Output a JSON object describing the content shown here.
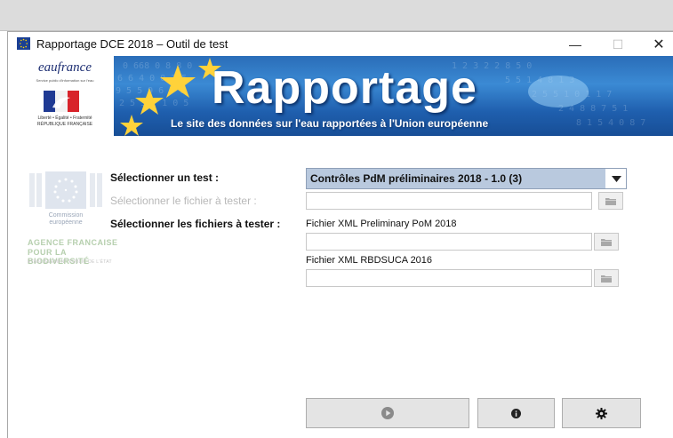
{
  "window": {
    "title": "Rapportage DCE 2018 – Outil de test",
    "controls": {
      "minimize": "—",
      "maximize": "☐",
      "close": "✕"
    }
  },
  "logos": {
    "eaufrance": {
      "name": "eaufrance",
      "tagline": "Service public d'information sur l'eau"
    },
    "republique": {
      "motto": "Liberté • Égalité • Fraternité",
      "name": "RÉPUBLIQUE FRANÇAISE"
    },
    "commission": {
      "line1": "Commission",
      "line2": "européenne"
    },
    "afb": {
      "line1": "AGENCE FRANCAISE",
      "line2": "POUR LA BIODIVERSITÉ",
      "line3": "ÉTABLISSEMENT PUBLIC DE L'ÉTAT"
    }
  },
  "banner": {
    "title": "Rapportage",
    "subtitle": "Le site des données sur l'eau rapportées à l'Union européenne"
  },
  "form": {
    "select_test_label": "Sélectionner un test :",
    "select_test_value": "Contrôles PdM préliminaires 2018 - 1.0 (3)",
    "select_file_label": "Sélectionner le fichier à tester :",
    "select_files_label": "Sélectionner les fichiers à tester :",
    "file1_label": "Fichier XML Preliminary PoM 2018",
    "file2_label": "Fichier XML RBDSUCA 2016",
    "single_file_value": "",
    "file1_value": "",
    "file2_value": ""
  },
  "icons": {
    "app": "eu-flag-icon",
    "dropdown": "chevron-down-icon",
    "browse": "folder-icon",
    "run": "play-icon",
    "info": "info-icon",
    "settings": "gear-icon"
  },
  "colors": {
    "combo_selected_bg": "#b9c9de",
    "banner_blue": "#2a6db8",
    "disabled_text": "#b8b8b8",
    "button_bg": "#e4e4e4"
  }
}
